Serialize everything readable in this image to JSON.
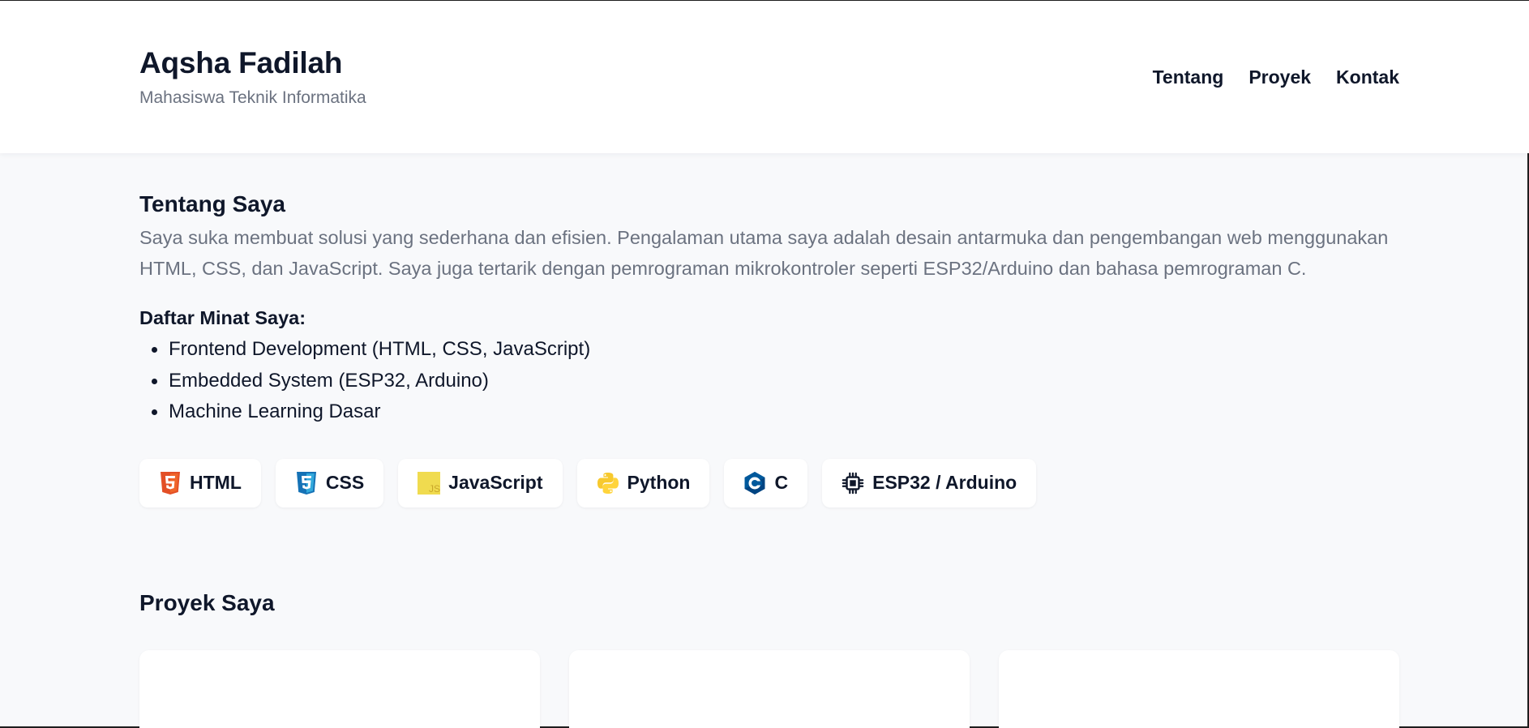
{
  "header": {
    "name": "Aqsha Fadilah",
    "subtitle": "Mahasiswa Teknik Informatika",
    "nav": [
      {
        "label": "Tentang"
      },
      {
        "label": "Proyek"
      },
      {
        "label": "Kontak"
      }
    ]
  },
  "about": {
    "title": "Tentang Saya",
    "text": "Saya suka membuat solusi yang sederhana dan efisien. Pengalaman utama saya adalah desain antarmuka dan pengembangan web menggunakan HTML, CSS, dan JavaScript. Saya juga tertarik dengan pemrograman mikrokontroler seperti ESP32/Arduino dan bahasa pemrograman C.",
    "interests_title": "Daftar Minat Saya:",
    "interests": [
      "Frontend Development (HTML, CSS, JavaScript)",
      "Embedded System (ESP32, Arduino)",
      "Machine Learning Dasar"
    ]
  },
  "skills": [
    {
      "label": "HTML",
      "icon": "html5-icon",
      "color": "#e34f26"
    },
    {
      "label": "CSS",
      "icon": "css3-icon",
      "color": "#1572b6"
    },
    {
      "label": "JavaScript",
      "icon": "javascript-icon",
      "color": "#f0db4f"
    },
    {
      "label": "Python",
      "icon": "python-icon",
      "color": "#ffd43b"
    },
    {
      "label": "C",
      "icon": "c-language-icon",
      "color": "#004482"
    },
    {
      "label": "ESP32 / Arduino",
      "icon": "chip-icon",
      "color": "#0f172a"
    }
  ],
  "projects": {
    "title": "Proyek Saya"
  }
}
